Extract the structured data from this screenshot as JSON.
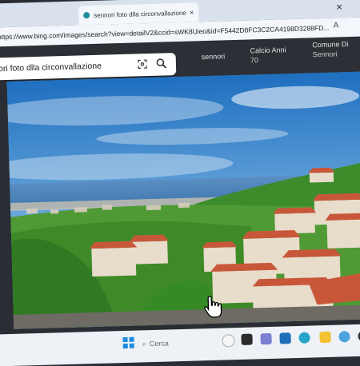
{
  "browser": {
    "tab_title": "sennori foto dlla circonvallazione",
    "tab_close": "×",
    "window_close": "×",
    "url": "https://www.bing.com/images/search?view=detailV2&ccid=sWK8Uieo&id=F5442D8FC3C2CA4198D3288FD...",
    "read_aloud": "A"
  },
  "bing": {
    "search_query": "ori foto dlla circonvallazione",
    "related": [
      {
        "title": "sennori",
        "subtitle": ""
      },
      {
        "title": "Calcio Anni",
        "subtitle": "70"
      },
      {
        "title": "Comune Di",
        "subtitle": "Sennori"
      }
    ]
  },
  "taskbar": {
    "search_label": "Cerca"
  },
  "colors": {
    "sky_top": "#1f6fc0",
    "sky_bottom": "#a8cbe4",
    "sea": "#3d7ab8",
    "vegetation": "#3f8f2a",
    "roofs": "#c8573a",
    "taskbar_accent": "#1d8ce0"
  }
}
